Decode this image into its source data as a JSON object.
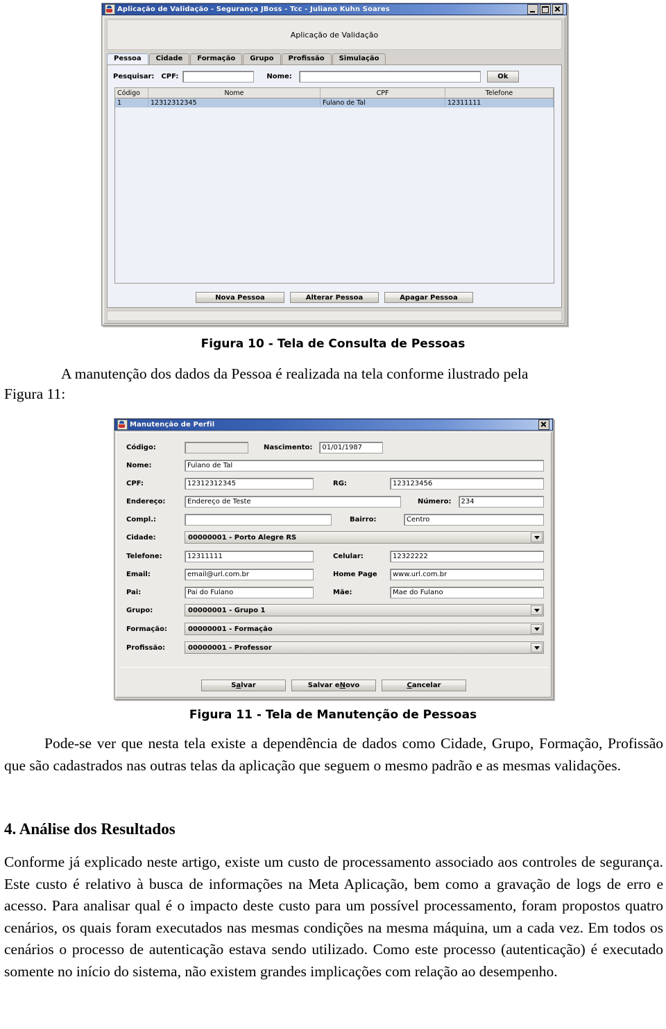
{
  "figure10": {
    "window": {
      "title": "Aplicação de Validação - Segurança JBoss - Tcc - Juliano Kuhn Soares",
      "icon": "java-coffee-cup-icon",
      "minimize": "minimize-icon",
      "maximize": "maximize-icon",
      "close": "close-icon"
    },
    "app_header": "Aplicação de Validação",
    "tabs": [
      {
        "label": "Pessoa",
        "active": true
      },
      {
        "label": "Cidade",
        "active": false
      },
      {
        "label": "Formação",
        "active": false
      },
      {
        "label": "Grupo",
        "active": false
      },
      {
        "label": "Profissão",
        "active": false
      },
      {
        "label": "Simulação",
        "active": false
      }
    ],
    "search": {
      "prefix_label": "Pesquisar:",
      "cpf_label": "CPF:",
      "cpf_value": "",
      "nome_label": "Nome:",
      "nome_value": "",
      "ok_label": "Ok"
    },
    "table": {
      "columns": [
        "Código",
        "Nome",
        "CPF",
        "Telefone"
      ],
      "rows": [
        [
          "1",
          "12312312345",
          "Fulano de Tal",
          "12311111"
        ]
      ]
    },
    "buttons": [
      "Nova Pessoa",
      "Alterar Pessoa",
      "Apagar Pessoa"
    ]
  },
  "caption10": "Figura 10 - Tela de Consulta de Pessoas",
  "paragraph1": "A manutenção dos dados da Pessoa é realizada na tela conforme ilustrado pela",
  "side_note": "Figura 11:",
  "figure11": {
    "window": {
      "title": "Manutenção de Perfil",
      "icon": "java-coffee-cup-icon",
      "close": "close-icon"
    },
    "fields": {
      "codigo_label": "Código:",
      "codigo_value": "",
      "nascimento_label": "Nascimento:",
      "nascimento_value": "01/01/1987",
      "nome_label": "Nome:",
      "nome_value": "Fulano de Tal",
      "cpf_label": "CPF:",
      "cpf_value": "12312312345",
      "rg_label": "RG:",
      "rg_value": "123123456",
      "endereco_label": "Endereço:",
      "endereco_value": "Endereço de Teste",
      "numero_label": "Número:",
      "numero_value": "234",
      "compl_label": "Compl.:",
      "compl_value": "",
      "bairro_label": "Bairro:",
      "bairro_value": "Centro",
      "cidade_label": "Cidade:",
      "cidade_value": "00000001 - Porto Alegre RS",
      "telefone_label": "Telefone:",
      "telefone_value": "12311111",
      "celular_label": "Celular:",
      "celular_value": "12322222",
      "email_label": "Email:",
      "email_value": "email@url.com.br",
      "homepage_label": "Home Page",
      "homepage_value": "www.url.com.br",
      "pai_label": "Pai:",
      "pai_value": "Pai do Fulano",
      "mae_label": "Mãe:",
      "mae_value": "Mae do Fulano",
      "grupo_label": "Grupo:",
      "grupo_value": "00000001 - Grupo 1",
      "formacao_label": "Formação:",
      "formacao_value": "00000001 - Formação",
      "profissao_label": "Profissão:",
      "profissao_value": "00000001 - Professor"
    },
    "buttons": [
      {
        "prefix": "S",
        "mnemonic": "a",
        "suffix": "lvar"
      },
      {
        "prefix": "Salvar e ",
        "mnemonic": "N",
        "suffix": "ovo"
      },
      {
        "prefix": "",
        "mnemonic": "C",
        "suffix": "ancelar"
      }
    ]
  },
  "caption11": "Figura 11 - Tela de Manutenção de Pessoas",
  "paragraph2": "Pode-se ver que nesta tela existe a dependência de dados como Cidade, Grupo, Formação, Profissão que são cadastrados nas outras telas da aplicação que seguem o mesmo padrão e as mesmas validações.",
  "section_heading": "4. Análise dos Resultados",
  "paragraph3": "Conforme já explicado neste artigo, existe um custo de processamento associado aos controles de segurança. Este custo é relativo à busca de informações na Meta Aplicação, bem como a gravação de logs de erro e acesso. Para analisar qual é o impacto deste custo para um possível processamento, foram propostos quatro cenários, os quais foram executados nas mesmas condições na mesma máquina, um a cada vez. Em todos os cenários o processo de autenticação estava sendo utilizado. Como este processo (autenticação) é executado somente no início do sistema, não existem grandes implicações com relação ao desempenho."
}
